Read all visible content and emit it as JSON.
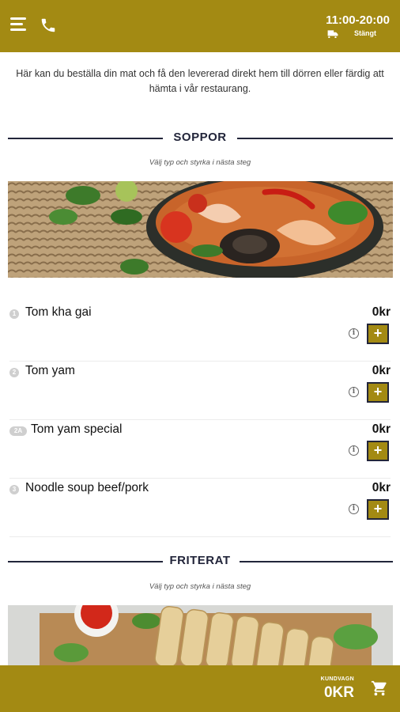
{
  "header": {
    "hours": "11:00-20:00",
    "status": "Stängt"
  },
  "intro": "Här kan du beställa din mat och få den levererad direkt hem till dörren eller färdig att hämta i vår restaurang.",
  "sections": [
    {
      "title": "SOPPOR",
      "subtitle": "Välj typ och styrka i nästa steg",
      "items": [
        {
          "num": "1",
          "name": "Tom kha gai",
          "price": "0kr"
        },
        {
          "num": "2",
          "name": "Tom yam",
          "price": "0kr"
        },
        {
          "num": "2A",
          "name": "Tom yam special",
          "price": "0kr"
        },
        {
          "num": "3",
          "name": "Noodle soup beef/pork",
          "price": "0kr"
        }
      ]
    },
    {
      "title": "FRITERAT",
      "subtitle": "Välj typ och styrka i nästa steg"
    }
  ],
  "item_actions": {
    "info": "i",
    "add": "+"
  },
  "footer": {
    "cart_label": "KUNDVAGN",
    "cart_total": "0KR"
  },
  "colors": {
    "brand": "#a38a13",
    "dark": "#22253a"
  },
  "icons": [
    "menu-icon",
    "phone-icon",
    "truck-icon",
    "info-icon",
    "plus-icon",
    "cart-icon"
  ]
}
